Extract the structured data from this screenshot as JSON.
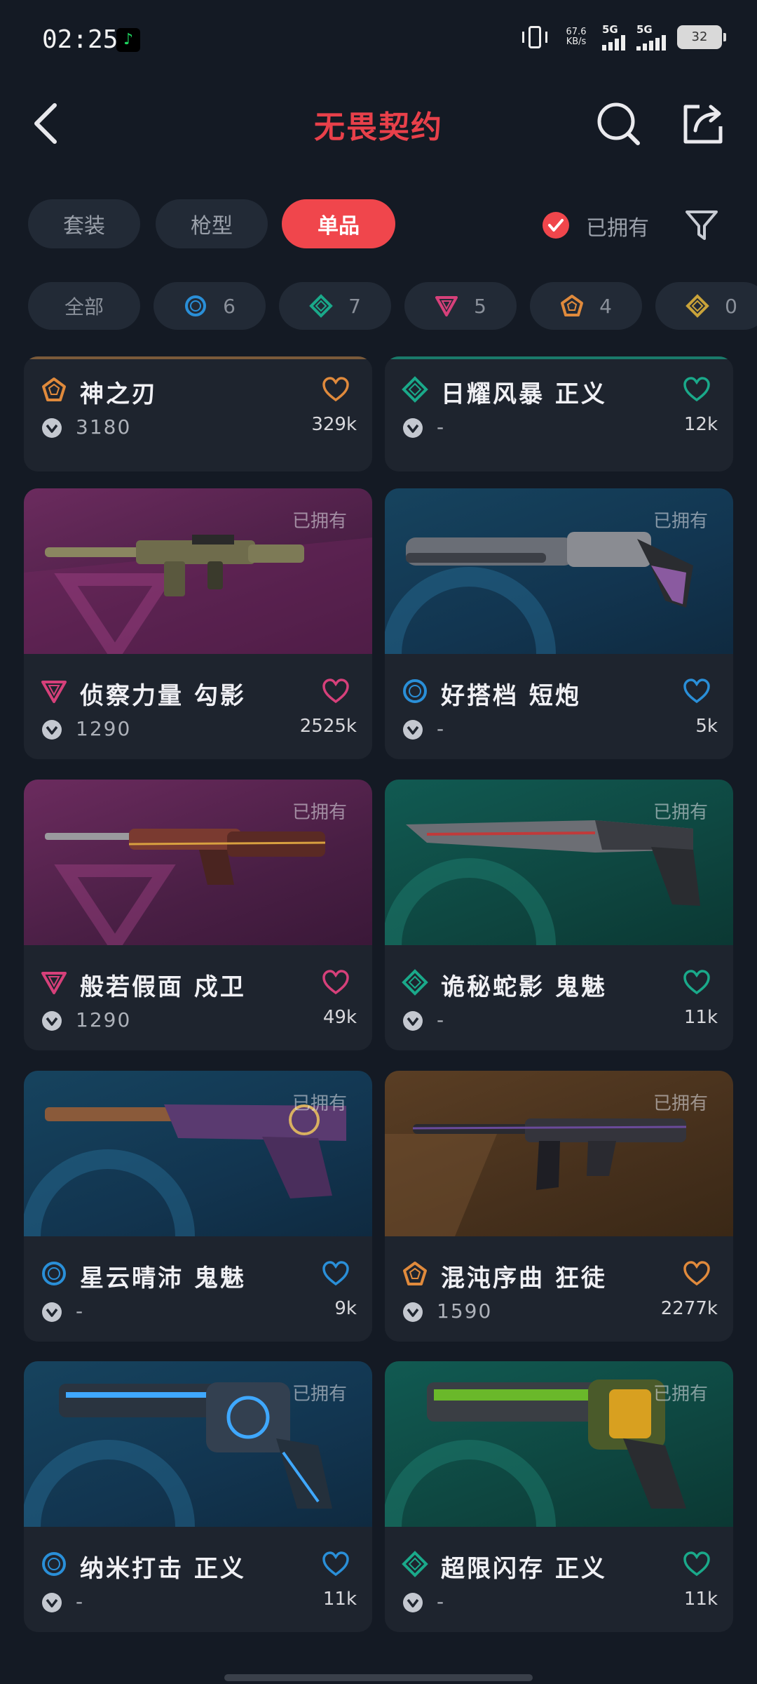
{
  "status_bar": {
    "time": "02:25",
    "net_speed": "67.6",
    "net_unit": "KB/s",
    "sig1": "5G",
    "sig2": "5G",
    "battery": "32"
  },
  "header": {
    "title": "无畏契约"
  },
  "tabs": [
    {
      "label": "套装",
      "active": false
    },
    {
      "label": "枪型",
      "active": false
    },
    {
      "label": "单品",
      "active": true
    }
  ],
  "owned_filter_label": "已拥有",
  "chips": [
    {
      "label": "全部",
      "tier": "all"
    },
    {
      "label": "6",
      "tier": "select",
      "color": "#2a8fd8"
    },
    {
      "label": "7",
      "tier": "deluxe",
      "color": "#1aa98a"
    },
    {
      "label": "5",
      "tier": "premium",
      "color": "#d6407a"
    },
    {
      "label": "4",
      "tier": "exclusive",
      "color": "#e08a3c"
    },
    {
      "label": "0",
      "tier": "ultra",
      "color": "#c9a33a"
    }
  ],
  "colors": {
    "accent": "#f0464c",
    "select": "#2a8fd8",
    "deluxe": "#1aa98a",
    "premium": "#d6407a",
    "exclusive": "#e08a3c"
  },
  "cards": [
    {
      "name": "神之刃",
      "tier": "exclusive",
      "price": "3180",
      "likes": "329k",
      "owned_tag": "",
      "partial": true
    },
    {
      "name": "日耀风暴 正义",
      "tier": "deluxe",
      "price": "-",
      "likes": "12k",
      "owned_tag": "",
      "partial": true
    },
    {
      "name": "侦察力量 勾影",
      "tier": "premium",
      "price": "1290",
      "likes": "2525k",
      "owned_tag": "已拥有"
    },
    {
      "name": "好搭档 短炮",
      "tier": "select",
      "price": "-",
      "likes": "5k",
      "owned_tag": "已拥有"
    },
    {
      "name": "般若假面 戍卫",
      "tier": "premium",
      "price": "1290",
      "likes": "49k",
      "owned_tag": "已拥有"
    },
    {
      "name": "诡秘蛇影 鬼魅",
      "tier": "deluxe",
      "price": "-",
      "likes": "11k",
      "owned_tag": "已拥有"
    },
    {
      "name": "星云晴沛 鬼魅",
      "tier": "select",
      "price": "-",
      "likes": "9k",
      "owned_tag": "已拥有"
    },
    {
      "name": "混沌序曲 狂徒",
      "tier": "exclusive",
      "price": "1590",
      "likes": "2277k",
      "owned_tag": "已拥有"
    },
    {
      "name": "纳米打击 正义",
      "tier": "select",
      "price": "-",
      "likes": "11k",
      "owned_tag": "已拥有"
    },
    {
      "name": "超限闪存 正义",
      "tier": "deluxe",
      "price": "-",
      "likes": "11k",
      "owned_tag": "已拥有"
    }
  ]
}
